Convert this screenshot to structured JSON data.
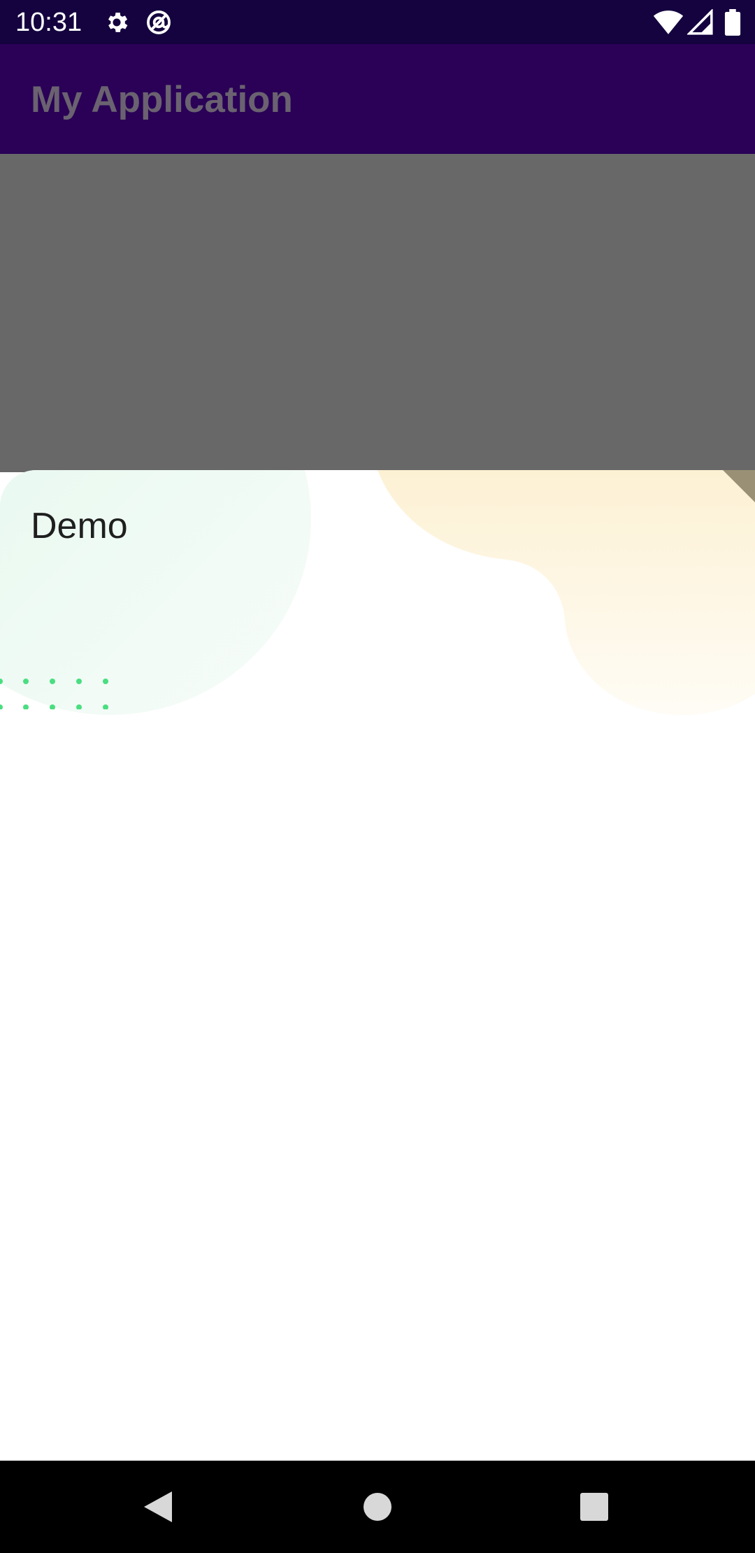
{
  "status_bar": {
    "time": "10:31",
    "icons": [
      "gear-icon",
      "at-sign-icon",
      "wifi-icon",
      "signal-icon",
      "battery-icon"
    ]
  },
  "app_bar": {
    "title": "My Application"
  },
  "bottom_sheet": {
    "title": "Demo"
  },
  "nav_bar": {
    "icons": [
      "back-icon",
      "home-icon",
      "recents-icon"
    ]
  },
  "colors": {
    "status_bar": "#14033f",
    "app_bar": "#2a0157",
    "scrim": "#686868",
    "dots": "#4ade80",
    "green_blob": "#e2f7ec",
    "yellow_blob": "#fdf1d4"
  }
}
